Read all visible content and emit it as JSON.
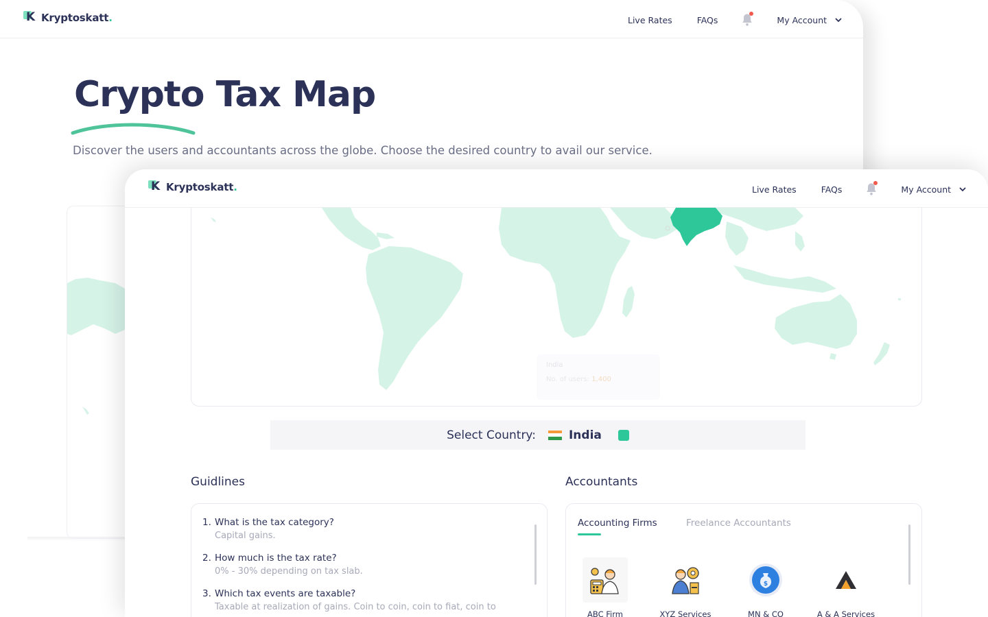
{
  "brand": {
    "name": "Kryptoskatt",
    "dot": ".",
    "logo_letter": "K"
  },
  "nav": {
    "live_rates": "Live Rates",
    "faqs": "FAQs",
    "my_account": "My Account"
  },
  "hero": {
    "title": "Crypto Tax Map",
    "subtitle": "Discover the users and accountants across the globe. Choose the desired country to avail our service."
  },
  "map": {
    "highlight_color": "#2ec79a",
    "land_color": "#d6f3e8",
    "tooltip": {
      "country": "India",
      "users_label": "No. of users:",
      "users_value": "1,400"
    }
  },
  "select_country": {
    "label": "Select Country:",
    "country": "India",
    "color": "#2ec79a"
  },
  "guidelines": {
    "title": "Guidlines",
    "items": [
      {
        "num": "1.",
        "question": "What is the tax category?",
        "answer": "Capital gains."
      },
      {
        "num": "2.",
        "question": "How much is the tax rate?",
        "answer": "0% - 30% depending on tax slab."
      },
      {
        "num": "3.",
        "question": "Which tax events are taxable?",
        "answer": "Taxable at realization of gains. Coin to coin, coin to fiat, coin to"
      }
    ]
  },
  "accountants": {
    "title": "Accountants",
    "tabs": [
      "Accounting Firms",
      "Freelance Accountants"
    ],
    "firms": [
      {
        "name": "ABC Firm",
        "icon": "accountant-icon"
      },
      {
        "name": "XYZ Services",
        "icon": "businessman-gear-icon"
      },
      {
        "name": "MN & CO",
        "icon": "money-bag-icon"
      },
      {
        "name": "A & A Services",
        "icon": "triangle-logo-icon"
      }
    ]
  }
}
